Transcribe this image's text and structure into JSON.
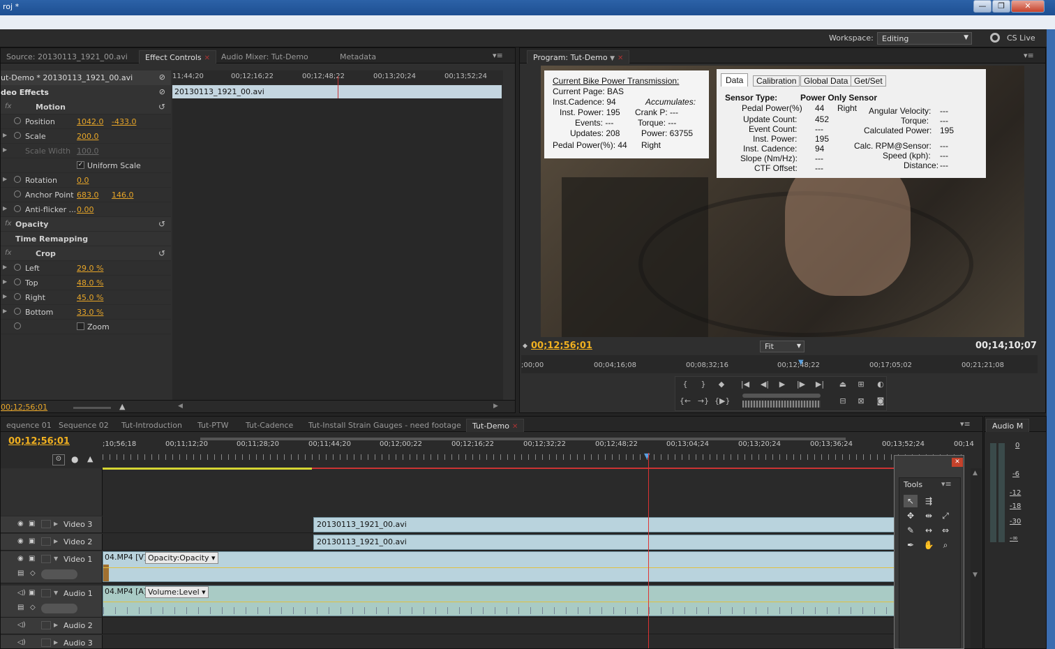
{
  "window": {
    "title": "roj *",
    "buttons": {
      "minimize": "—",
      "restore": "❐",
      "close": "✕"
    }
  },
  "workspace": {
    "label": "Workspace:",
    "value": "Editing",
    "cs_live": "CS Live"
  },
  "source_panel": {
    "tabs": [
      {
        "label": "Source: 20130113_1921_00.avi"
      },
      {
        "label": "Effect Controls"
      },
      {
        "label": "Audio Mixer: Tut-Demo"
      },
      {
        "label": "Metadata"
      }
    ],
    "clip_path": "ut-Demo * 20130113_1921_00.avi",
    "ruler": [
      "11;44;20",
      "00;12;16;22",
      "00;12;48;22",
      "00;13;20;24",
      "00;13;52;24"
    ],
    "clip_bar": "20130113_1921_00.avi",
    "section": "deo Effects",
    "effects": {
      "motion": "Motion",
      "position": {
        "name": "Position",
        "x": "1042.0",
        "y": "-433.0"
      },
      "scale": {
        "name": "Scale",
        "value": "200.0"
      },
      "scale_width": {
        "name": "Scale Width",
        "value": "100.0"
      },
      "uniform_scale": "Uniform Scale",
      "rotation": {
        "name": "Rotation",
        "value": "0.0"
      },
      "anchor": {
        "name": "Anchor Point",
        "x": "683.0",
        "y": "146.0"
      },
      "antiflicker": {
        "name": "Anti-flicker ...",
        "value": "0.00"
      },
      "opacity": "Opacity",
      "time_remapping": "Time Remapping",
      "crop": "Crop",
      "left": {
        "name": "Left",
        "value": "29.0 %"
      },
      "top": {
        "name": "Top",
        "value": "48.0 %"
      },
      "right": {
        "name": "Right",
        "value": "45.0 %"
      },
      "bottom": {
        "name": "Bottom",
        "value": "33.0 %"
      },
      "zoom": "Zoom"
    },
    "timecode": "00;12;56;01"
  },
  "program": {
    "tab": "Program: Tut-Demo",
    "current_tc": "00;12;56;01",
    "duration_tc": "00;14;10;07",
    "fit": "Fit",
    "ruler": [
      ";00;00",
      "00;04;16;08",
      "00;08;32;16",
      "00;12;48;22",
      "00;17;05;02",
      "00;21;21;08"
    ],
    "overlay_left": {
      "title": "Current Bike Power Transmission:",
      "page": "Current Page: BAS",
      "cadence": "Inst.Cadence: 94",
      "accumulates": "Accumulates:",
      "inst_power": "Inst. Power: 195",
      "crank": "Crank P:  ---",
      "events": "Events:  ---",
      "torque": "Torque:  ---",
      "updates": "Updates: 208",
      "power": "Power:  63755",
      "pedal": "Pedal Power(%):  44",
      "right": "Right"
    },
    "overlay_right": {
      "tabs": [
        "Data",
        "Calibration",
        "Global Data",
        "Get/Set"
      ],
      "sensor_type": "Sensor Type:",
      "sensor_val": "Power Only Sensor",
      "labels": [
        "Pedal Power(%)",
        "Update Count:",
        "Event Count:",
        "Inst. Power:",
        "Inst. Cadence:",
        "Slope (Nm/Hz):",
        "CTF Offset:"
      ],
      "values": [
        "44",
        "452",
        "---",
        "195",
        "94",
        "---",
        "---"
      ],
      "pedal_side": "Right",
      "labels2": [
        "Angular Velocity:",
        "Torque:",
        "Calculated Power:",
        "Calc. RPM@Sensor:",
        "Speed (kph):",
        "Distance:"
      ],
      "values2": [
        "---",
        "---",
        "195",
        "---",
        "---",
        "---"
      ]
    }
  },
  "timeline": {
    "tabs": [
      "equence 01",
      "Sequence 02",
      "Tut-Introduction",
      "Tut-PTW",
      "Tut-Cadence",
      "Tut-Install Strain Gauges - need footage",
      "Tut-Demo"
    ],
    "timecode": "00;12;56;01",
    "ruler": [
      ";10;56;18",
      "00;11;12;20",
      "00;11;28;20",
      "00;11;44;20",
      "00;12;00;22",
      "00;12;16;22",
      "00;12;32;22",
      "00;12;48;22",
      "00;13;04;24",
      "00;13;20;24",
      "00;13;36;24",
      "00;13;52;24",
      "00;14"
    ],
    "tracks": {
      "video3": "Video 3",
      "video2": "Video 2",
      "video1": "Video 1",
      "audio1": "Audio 1",
      "audio2": "Audio 2",
      "audio3": "Audio 3"
    },
    "clips": {
      "v3": "20130113_1921_00.avi",
      "v2": "20130113_1921_00.avi",
      "v1": "04.MP4 [V]",
      "v1_fx": "Opacity:Opacity",
      "a1": "04.MP4 [A]",
      "a1_fx": "Volume:Level"
    }
  },
  "audio_meter": {
    "title": "Audio M",
    "scale": [
      "0",
      "-6",
      "-12",
      "-18",
      "-30",
      "-∞"
    ]
  },
  "tools": {
    "title": "Tools"
  }
}
